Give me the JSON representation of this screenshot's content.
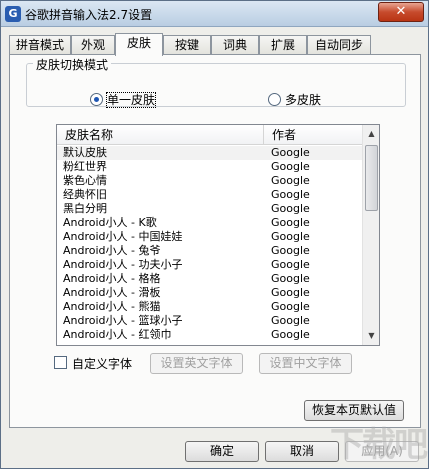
{
  "window": {
    "title": "谷歌拼音输入法2.7设置",
    "close_symbol": "✕"
  },
  "tabs": [
    "拼音模式",
    "外观",
    "皮肤",
    "按键",
    "词典",
    "扩展",
    "自动同步"
  ],
  "active_tab_index": 2,
  "skin_mode": {
    "legend": "皮肤切换模式",
    "options": [
      {
        "label": "单一皮肤",
        "checked": true
      },
      {
        "label": "多皮肤",
        "checked": false
      }
    ]
  },
  "skin_list": {
    "headers": {
      "name": "皮肤名称",
      "author": "作者"
    },
    "rows": [
      {
        "name": "默认皮肤",
        "author": "Google"
      },
      {
        "name": "粉红世界",
        "author": "Google"
      },
      {
        "name": "紫色心情",
        "author": "Google"
      },
      {
        "name": "经典怀旧",
        "author": "Google"
      },
      {
        "name": "黑白分明",
        "author": "Google"
      },
      {
        "name": "Android小人 - K歌",
        "author": "Google"
      },
      {
        "name": "Android小人 - 中国娃娃",
        "author": "Google"
      },
      {
        "name": "Android小人 - 兔爷",
        "author": "Google"
      },
      {
        "name": "Android小人 - 功夫小子",
        "author": "Google"
      },
      {
        "name": "Android小人 - 格格",
        "author": "Google"
      },
      {
        "name": "Android小人 - 滑板",
        "author": "Google"
      },
      {
        "name": "Android小人 - 熊猫",
        "author": "Google"
      },
      {
        "name": "Android小人 - 篮球小子",
        "author": "Google"
      },
      {
        "name": "Android小人 - 红领巾",
        "author": "Google"
      }
    ]
  },
  "custom_font": {
    "checkbox_label": "自定义字体",
    "checked": false,
    "english_font_button": "设置英文字体",
    "chinese_font_button": "设置中文字体"
  },
  "restore_defaults_button": "恢复本页默认值",
  "footer": {
    "ok": "确定",
    "cancel": "取消",
    "apply": "应用(A)"
  },
  "watermark": "下载吧"
}
